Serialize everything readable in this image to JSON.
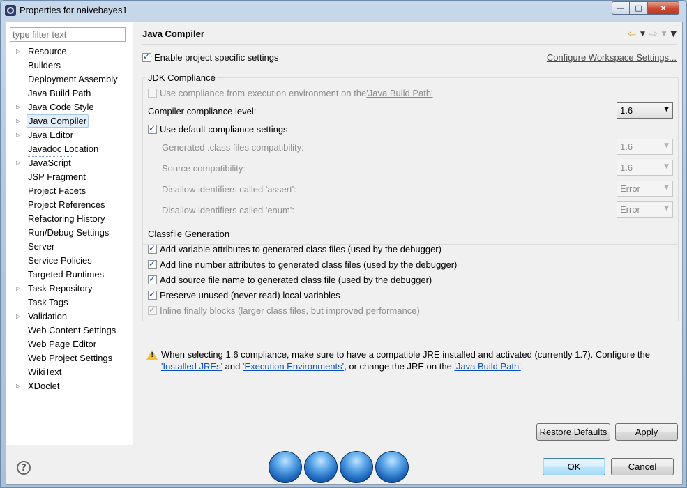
{
  "window": {
    "title": "Properties for naivebayes1",
    "controls": {
      "minimize": "—",
      "maximize": "□",
      "close": "✕"
    }
  },
  "sidebar": {
    "filter_placeholder": "type filter text",
    "items": [
      {
        "label": "Resource",
        "expandable": true
      },
      {
        "label": "Builders",
        "expandable": false
      },
      {
        "label": "Deployment Assembly",
        "expandable": false
      },
      {
        "label": "Java Build Path",
        "expandable": false
      },
      {
        "label": "Java Code Style",
        "expandable": true
      },
      {
        "label": "Java Compiler",
        "expandable": true,
        "selected": true
      },
      {
        "label": "Java Editor",
        "expandable": true
      },
      {
        "label": "Javadoc Location",
        "expandable": false
      },
      {
        "label": "JavaScript",
        "expandable": true,
        "selected_outline": true
      },
      {
        "label": "JSP Fragment",
        "expandable": false
      },
      {
        "label": "Project Facets",
        "expandable": false
      },
      {
        "label": "Project References",
        "expandable": false
      },
      {
        "label": "Refactoring History",
        "expandable": false
      },
      {
        "label": "Run/Debug Settings",
        "expandable": false
      },
      {
        "label": "Server",
        "expandable": false
      },
      {
        "label": "Service Policies",
        "expandable": false
      },
      {
        "label": "Targeted Runtimes",
        "expandable": false
      },
      {
        "label": "Task Repository",
        "expandable": true
      },
      {
        "label": "Task Tags",
        "expandable": false
      },
      {
        "label": "Validation",
        "expandable": true
      },
      {
        "label": "Web Content Settings",
        "expandable": false
      },
      {
        "label": "Web Page Editor",
        "expandable": false
      },
      {
        "label": "Web Project Settings",
        "expandable": false
      },
      {
        "label": "WikiText",
        "expandable": false
      },
      {
        "label": "XDoclet",
        "expandable": true
      }
    ]
  },
  "page": {
    "title": "Java Compiler",
    "enable_specific": {
      "label": "Enable project specific settings",
      "checked": true
    },
    "configure_link": "Configure Workspace Settings...",
    "jdk": {
      "group_title": "JDK Compliance",
      "use_env": {
        "label_prefix": "Use compliance from execution environment on the ",
        "link": "'Java Build Path'",
        "checked": false
      },
      "compliance_level_label": "Compiler compliance level:",
      "compliance_level_value": "1.6",
      "use_default": {
        "label": "Use default compliance settings",
        "checked": true
      },
      "generated_label": "Generated .class files compatibility:",
      "generated_value": "1.6",
      "source_label": "Source compatibility:",
      "source_value": "1.6",
      "assert_label": "Disallow identifiers called 'assert':",
      "assert_value": "Error",
      "enum_label": "Disallow identifiers called 'enum':",
      "enum_value": "Error"
    },
    "classfile": {
      "group_title": "Classfile Generation",
      "options": [
        {
          "label": "Add variable attributes to generated class files (used by the debugger)",
          "checked": true
        },
        {
          "label": "Add line number attributes to generated class files (used by the debugger)",
          "checked": true
        },
        {
          "label": "Add source file name to generated class file (used by the debugger)",
          "checked": true
        },
        {
          "label": "Preserve unused (never read) local variables",
          "checked": true
        },
        {
          "label": "Inline finally blocks (larger class files, but improved performance)",
          "checked": true,
          "disabled": true
        }
      ]
    },
    "warning": {
      "text_1": "When selecting 1.6 compliance, make sure to have a compatible JRE installed and activated (currently 1.7). Configure the ",
      "link_1": "'Installed JREs'",
      "text_2": " and ",
      "link_2": "'Execution Environments'",
      "text_3": ", or change the JRE on the ",
      "link_3": "'Java Build Path'",
      "text_4": "."
    },
    "restore_defaults": "Restore Defaults",
    "apply": "Apply"
  },
  "footer": {
    "help": "?",
    "ok": "OK",
    "cancel": "Cancel"
  }
}
